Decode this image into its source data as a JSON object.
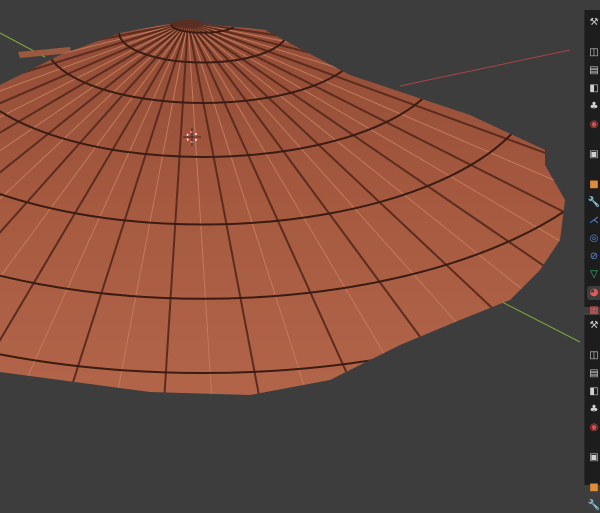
{
  "app": "3D viewport",
  "colors": {
    "background": "#3d3d3d",
    "x_axis": "#a8444a",
    "y_axis": "#7fa83a",
    "roof_tile": "#a0563d",
    "panel": "#1d1d1d"
  },
  "properties_panel_top": {
    "tabs": [
      {
        "icon": "tool-icon",
        "glyph": "⚒",
        "color": "#cfcfcf"
      },
      {
        "icon": "render-icon",
        "glyph": "◫",
        "color": "#cfcfcf"
      },
      {
        "icon": "output-icon",
        "glyph": "▤",
        "color": "#cfcfcf"
      },
      {
        "icon": "view-layer-icon",
        "glyph": "◧",
        "color": "#cfcfcf"
      },
      {
        "icon": "scene-icon",
        "glyph": "♣",
        "color": "#cfcfcf"
      },
      {
        "icon": "world-icon",
        "glyph": "◉",
        "color": "#d0504e"
      },
      {
        "icon": "collection-icon",
        "glyph": "▣",
        "color": "#cfcfcf"
      },
      {
        "icon": "object-icon",
        "glyph": "■",
        "color": "#e08a3a"
      },
      {
        "icon": "modifier-icon",
        "glyph": "🔧",
        "color": "#5a8fe0"
      },
      {
        "icon": "particles-icon",
        "glyph": "⋌",
        "color": "#5a8fe0"
      },
      {
        "icon": "physics-icon",
        "glyph": "◎",
        "color": "#5a8fe0"
      },
      {
        "icon": "constraints-icon",
        "glyph": "⊘",
        "color": "#5a8fe0"
      },
      {
        "icon": "data-icon",
        "glyph": "▽",
        "color": "#36c070"
      },
      {
        "icon": "material-icon",
        "glyph": "◕",
        "color": "#e05a5a",
        "active": true
      },
      {
        "icon": "texture-icon",
        "glyph": "▦",
        "color": "#e05a5a"
      }
    ]
  },
  "properties_panel_bottom": {
    "tabs": [
      {
        "icon": "tool-icon",
        "glyph": "⚒",
        "color": "#cfcfcf"
      },
      {
        "icon": "render-icon",
        "glyph": "◫",
        "color": "#cfcfcf"
      },
      {
        "icon": "output-icon",
        "glyph": "▤",
        "color": "#cfcfcf"
      },
      {
        "icon": "view-layer-icon",
        "glyph": "◧",
        "color": "#cfcfcf"
      },
      {
        "icon": "scene-icon",
        "glyph": "♣",
        "color": "#cfcfcf"
      },
      {
        "icon": "world-icon",
        "glyph": "◉",
        "color": "#d0504e"
      },
      {
        "icon": "collection-icon",
        "glyph": "▣",
        "color": "#cfcfcf"
      },
      {
        "icon": "object-icon",
        "glyph": "■",
        "color": "#e08a3a"
      },
      {
        "icon": "modifier-icon",
        "glyph": "🔧",
        "color": "#5a8fe0",
        "active": true
      }
    ]
  }
}
